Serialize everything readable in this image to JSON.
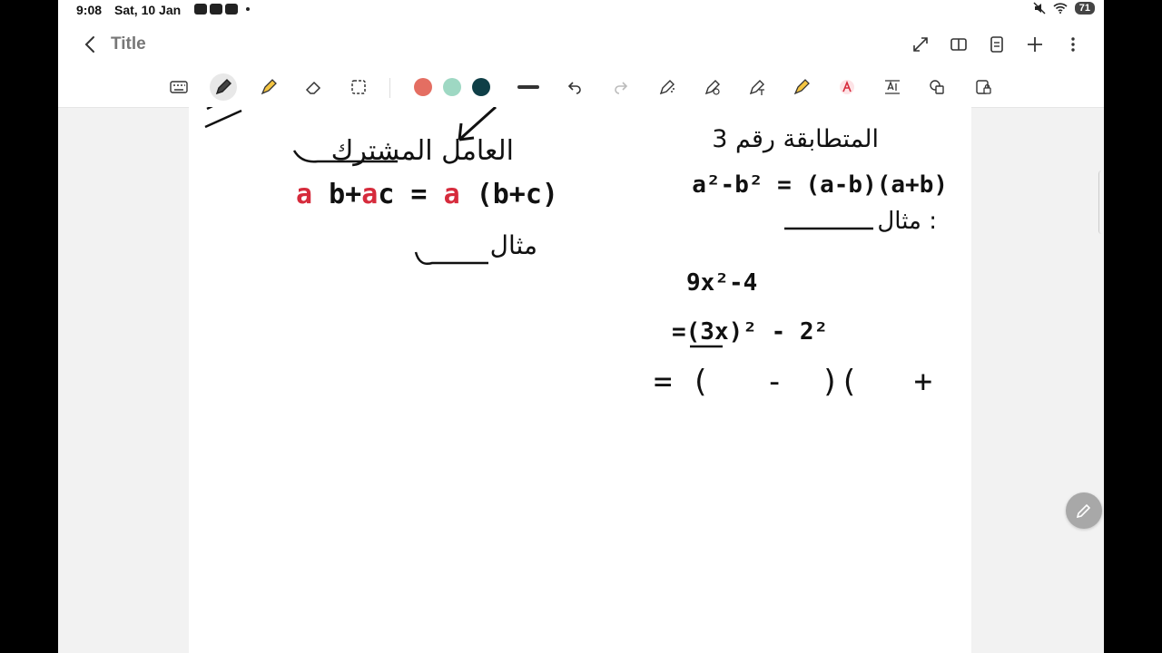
{
  "status": {
    "time": "9:08",
    "date": "Sat, 10 Jan",
    "battery": "71"
  },
  "header": {
    "title": "Title"
  },
  "colors": {
    "coral": "#e46e62",
    "mint": "#9ed8c3",
    "teal": "#0f3f47",
    "ink": "#111111",
    "red": "#d62b3c"
  },
  "icons": {
    "titlebar": [
      "expand-icon",
      "book-icon",
      "page-list-icon",
      "add-icon",
      "more-icon"
    ],
    "toolbar": [
      "keyboard-icon",
      "pen-icon",
      "highlighter-icon",
      "eraser-icon",
      "lasso-icon",
      "line-thickness-icon",
      "undo-icon",
      "redo-icon",
      "spray-pen-icon",
      "shape-pen-icon",
      "text-pen-icon",
      "highlight-pen-icon",
      "text-color-icon",
      "text-tool-icon",
      "shapes-icon",
      "lock-icon"
    ]
  },
  "notes": {
    "left_heading": "العامل المشترك",
    "left_formula": [
      "a",
      " b+",
      "a",
      "c = ",
      "a",
      " (b+c)"
    ],
    "left_example": "مثال",
    "right_heading": "المتطابقة رقم 3",
    "right_formula": "a²-b² = (a-b)(a+b)",
    "right_example": "مثال :",
    "work_line1": "9x²-4",
    "work_line2": "=(3x)² - 2²",
    "work_line3": "= (   -  )(   +  )"
  }
}
